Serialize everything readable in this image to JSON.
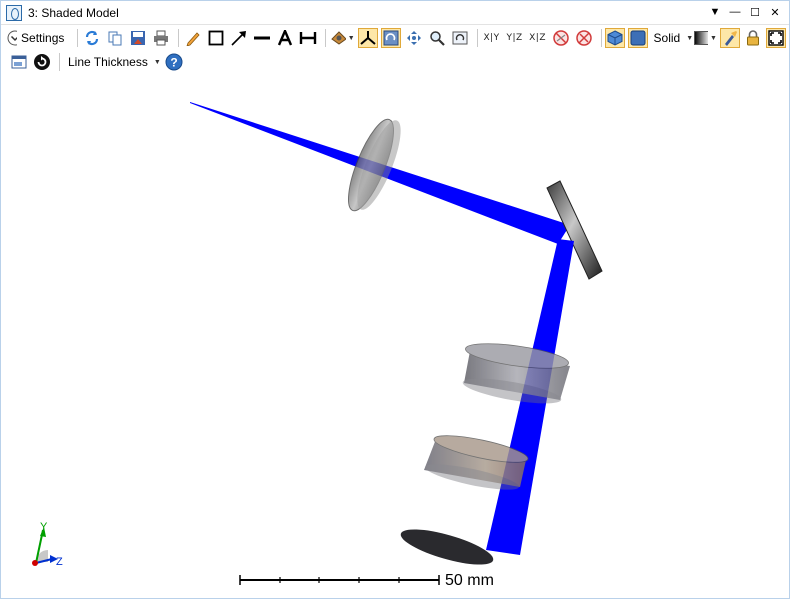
{
  "window": {
    "title": "3: Shaded Model"
  },
  "toolbar": {
    "settings_label": "Settings",
    "render_mode": "Solid",
    "line_thickness_label": "Line Thickness",
    "axis_views": [
      "X|Y",
      "Y|Z",
      "X|Z"
    ]
  },
  "view": {
    "scale_bar_label": "50 mm",
    "triad_labels": {
      "y": "Y",
      "z": "Z"
    },
    "beam_color": "#0000ff",
    "element_color": "#808080"
  }
}
